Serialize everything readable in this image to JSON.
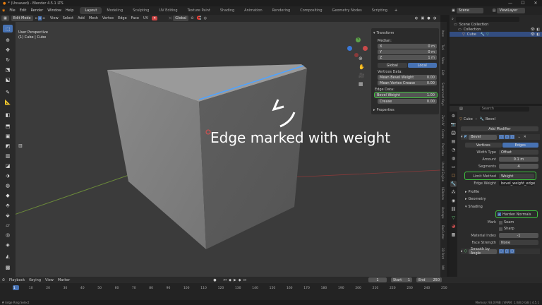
{
  "window": {
    "title": "* (Unsaved) - Blender 4.5.1 LTS"
  },
  "menubar": {
    "menus": [
      "File",
      "Edit",
      "Render",
      "Window",
      "Help"
    ],
    "workspaces": [
      "Layout",
      "Modeling",
      "Sculpting",
      "UV Editing",
      "Texture Paint",
      "Shading",
      "Animation",
      "Rendering",
      "Compositing",
      "Geometry Nodes",
      "Scripting"
    ],
    "active_workspace": "Layout",
    "scene": "Scene",
    "view_layer": "ViewLayer"
  },
  "viewport_header": {
    "mode": "Edit Mode",
    "menus": [
      "View",
      "Select",
      "Add",
      "Mesh",
      "Vertex",
      "Edge",
      "Face",
      "UV"
    ],
    "orientation": "Global",
    "overlay_label": "User Perspective",
    "object_label": "(1) Cube | Cube"
  },
  "annotation": {
    "text": "Edge marked with weight"
  },
  "npanel": {
    "header": "Transform",
    "median_label": "Median:",
    "x_label": "X",
    "x_value": "0 m",
    "y_label": "Y",
    "y_value": "0 m",
    "z_label": "Z",
    "z_value": "1 m",
    "global_label": "Global",
    "local_label": "Local",
    "vertices_data": "Vertices Data:",
    "mean_bevel_label": "Mean Bevel Weight",
    "mean_bevel_value": "0.00",
    "mean_crease_label": "Mean Vertex Crease",
    "mean_crease_value": "0.00",
    "edge_data": "Edge Data:",
    "bevel_weight_label": "Bevel Weight",
    "bevel_weight_value": "1.00",
    "crease_label": "Crease",
    "crease_value": "0.00",
    "properties": "Properties"
  },
  "side_tabs": [
    "Item",
    "Tool",
    "View",
    "Edit",
    "Screencast Keys",
    "Zen UV",
    "Create",
    "Precision",
    "Unreal Engine",
    "UEAddon",
    "Hardops",
    "BoxCutter",
    "3D Print",
    "MX"
  ],
  "outliner": {
    "scene_collection": "Scene Collection",
    "collection": "Collection",
    "cube": "Cube"
  },
  "properties": {
    "search_placeholder": "Search",
    "breadcrumb_object": "Cube",
    "breadcrumb_modifier": "Bevel",
    "add_modifier": "Add Modifier",
    "modifier_name": "Bevel",
    "tab_vertices": "Vertices",
    "tab_edges": "Edges",
    "width_type_label": "Width Type",
    "width_type_value": "Offset",
    "amount_label": "Amount",
    "amount_value": "0.1 m",
    "segments_label": "Segments",
    "segments_value": "4",
    "limit_method_label": "Limit Method",
    "limit_method_value": "Weight",
    "edge_weight_label": "Edge Weight",
    "edge_weight_value": "bevel_weight_edge",
    "profile": "Profile",
    "geometry": "Geometry",
    "shading": "Shading",
    "harden_normals": "Harden Normals",
    "mark_label": "Mark",
    "seam": "Seam",
    "sharp": "Sharp",
    "material_index_label": "Material Index",
    "material_index_value": "-1",
    "face_strength_label": "Face Strength",
    "face_strength_value": "None",
    "next_modifier": "Smooth by Angle"
  },
  "timeline": {
    "menus": [
      "Playback",
      "Keying",
      "View",
      "Marker"
    ],
    "current_frame": "1",
    "start_label": "Start",
    "start_value": "1",
    "end_label": "End",
    "end_value": "250",
    "ticks": [
      "1",
      "10",
      "20",
      "30",
      "40",
      "50",
      "60",
      "70",
      "80",
      "90",
      "100",
      "110",
      "120",
      "130",
      "140",
      "150",
      "160",
      "170",
      "180",
      "190",
      "200",
      "210",
      "220",
      "230",
      "240",
      "250"
    ]
  },
  "statusbar": {
    "left": "Edge Ring Select",
    "right": "Memory: 93.0 MiB | VRAM: 1.0/8.0 GiB | 4.5.1"
  },
  "colors": {
    "accent": "#4772b3",
    "highlight": "#3fc43f",
    "edge": "#4fa3ff"
  }
}
